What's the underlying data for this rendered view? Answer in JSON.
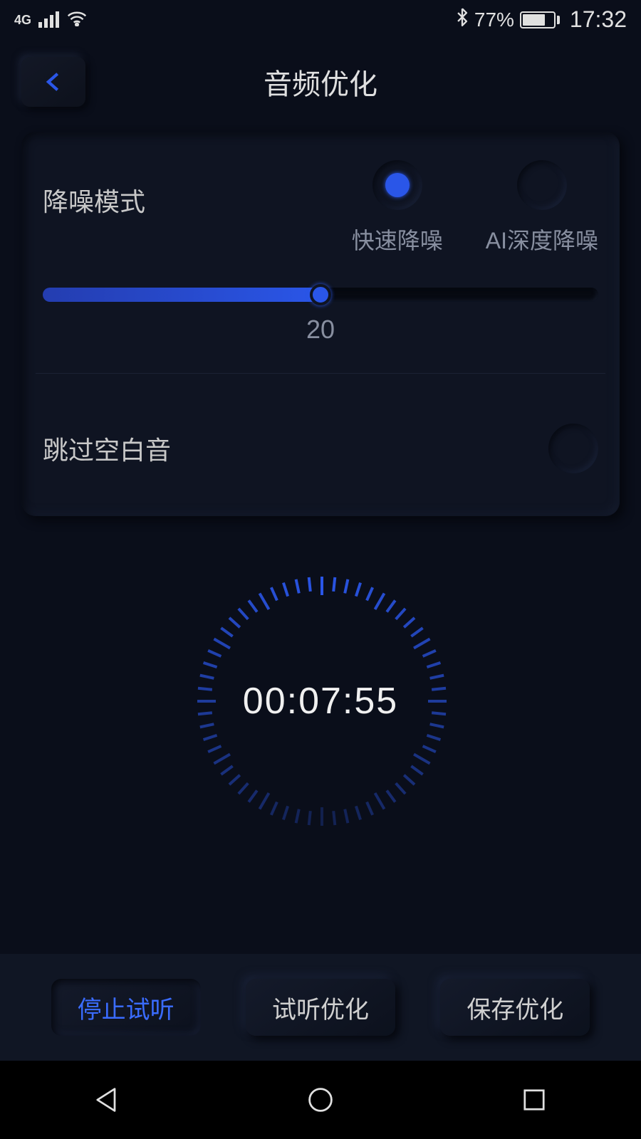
{
  "status": {
    "network": "4G",
    "battery_pct": "77%",
    "time": "17:32"
  },
  "header": {
    "title": "音频优化"
  },
  "noise": {
    "label": "降噪模式",
    "options": {
      "fast": "快速降噪",
      "ai": "AI深度降噪"
    },
    "slider_value": "20"
  },
  "skip": {
    "label": "跳过空白音"
  },
  "timer": {
    "display": "00:07:55"
  },
  "actions": {
    "stop": "停止试听",
    "preview": "试听优化",
    "save": "保存优化"
  }
}
